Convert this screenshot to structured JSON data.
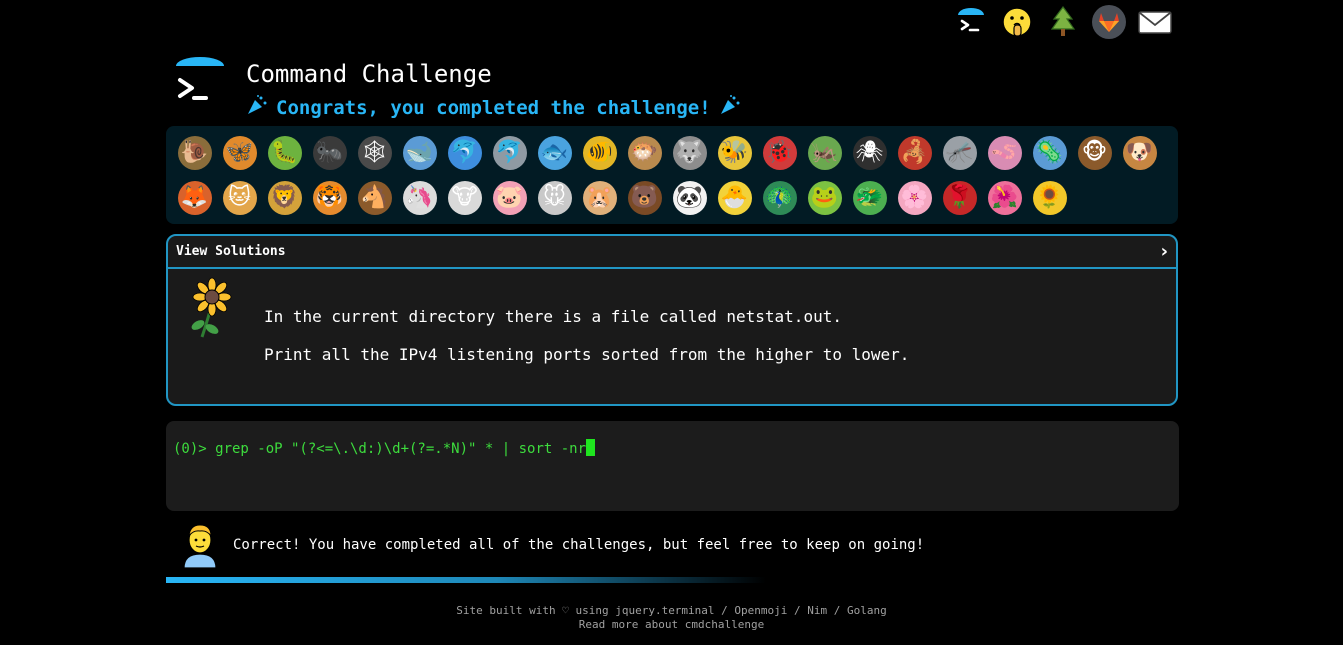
{
  "top_icons": [
    {
      "name": "terminal-icon"
    },
    {
      "name": "shushing-face-icon"
    },
    {
      "name": "tree-icon"
    },
    {
      "name": "gitlab-icon"
    },
    {
      "name": "mail-icon"
    }
  ],
  "header": {
    "title": "Command Challenge",
    "subtitle": "Congrats, you completed the challenge!",
    "accent_color": "#29b6f6"
  },
  "animals": [
    {
      "name": "snail-icon",
      "glyph": "🐌",
      "bg": "#8a6d3b"
    },
    {
      "name": "butterfly-icon",
      "glyph": "🦋",
      "bg": "#e08a2c"
    },
    {
      "name": "caterpillar-icon",
      "glyph": "🐛",
      "bg": "#6db33f"
    },
    {
      "name": "ant-icon",
      "glyph": "🐜",
      "bg": "#3a3a3a"
    },
    {
      "name": "spider-web-icon",
      "glyph": "🕸",
      "bg": "#4a4a4a"
    },
    {
      "name": "whale-icon",
      "glyph": "🐋",
      "bg": "#5b9bd5"
    },
    {
      "name": "dolphin-blue-icon",
      "glyph": "🐬",
      "bg": "#3e8ede"
    },
    {
      "name": "dolphin-gray-icon",
      "glyph": "🐬",
      "bg": "#8f9aa3"
    },
    {
      "name": "fish-icon",
      "glyph": "🐟",
      "bg": "#4aa3df"
    },
    {
      "name": "tropical-fish-icon",
      "glyph": "🐠",
      "bg": "#e3b626"
    },
    {
      "name": "blowfish-icon",
      "glyph": "🐡",
      "bg": "#b98a4e"
    },
    {
      "name": "wolf-icon",
      "glyph": "🐺",
      "bg": "#8d8d8d"
    },
    {
      "name": "bee-icon",
      "glyph": "🐝",
      "bg": "#e8c53a"
    },
    {
      "name": "ladybug-icon",
      "glyph": "🐞",
      "bg": "#d13b3b"
    },
    {
      "name": "cricket-icon",
      "glyph": "🦗",
      "bg": "#6aa84f"
    },
    {
      "name": "spider-icon",
      "glyph": "🕷",
      "bg": "#2f2f2f"
    },
    {
      "name": "scorpion-icon",
      "glyph": "🦂",
      "bg": "#c0392b"
    },
    {
      "name": "mosquito-icon",
      "glyph": "🦟",
      "bg": "#9aa0a6"
    },
    {
      "name": "worm-icon",
      "glyph": "🪱",
      "bg": "#d98cb3"
    },
    {
      "name": "microbe-icon",
      "glyph": "🦠",
      "bg": "#5b9bd5"
    },
    {
      "name": "monkey-icon",
      "glyph": "🐵",
      "bg": "#8b5a2b"
    },
    {
      "name": "dog-icon",
      "glyph": "🐶",
      "bg": "#c68642"
    },
    {
      "name": "fox-icon",
      "glyph": "🦊",
      "bg": "#d9622b"
    },
    {
      "name": "cat-icon",
      "glyph": "🐱",
      "bg": "#e3a64a"
    },
    {
      "name": "lion-icon",
      "glyph": "🦁",
      "bg": "#d4a23a"
    },
    {
      "name": "tiger-icon",
      "glyph": "🐯",
      "bg": "#e58b2e"
    },
    {
      "name": "horse-icon",
      "glyph": "🐴",
      "bg": "#8b5a2b"
    },
    {
      "name": "unicorn-icon",
      "glyph": "🦄",
      "bg": "#dcdcdc"
    },
    {
      "name": "cow-icon",
      "glyph": "🐮",
      "bg": "#d9d9d9"
    },
    {
      "name": "pig-icon",
      "glyph": "🐷",
      "bg": "#f2a0b5"
    },
    {
      "name": "mouse-icon",
      "glyph": "🐭",
      "bg": "#c9c9c9"
    },
    {
      "name": "hamster-icon",
      "glyph": "🐹",
      "bg": "#e0b07a"
    },
    {
      "name": "bear-icon",
      "glyph": "🐻",
      "bg": "#7a4a25"
    },
    {
      "name": "panda-icon",
      "glyph": "🐼",
      "bg": "#f2f2f2"
    },
    {
      "name": "hatching-chick-icon",
      "glyph": "🐣",
      "bg": "#f2d23a"
    },
    {
      "name": "peacock-icon",
      "glyph": "🦚",
      "bg": "#2e8b57"
    },
    {
      "name": "frog-icon",
      "glyph": "🐸",
      "bg": "#7cc242"
    },
    {
      "name": "dragon-icon",
      "glyph": "🐲",
      "bg": "#4caf50"
    },
    {
      "name": "cherry-blossom-icon",
      "glyph": "🌸",
      "bg": "#f4a7c1"
    },
    {
      "name": "rose-icon",
      "glyph": "🌹",
      "bg": "#c62828"
    },
    {
      "name": "hibiscus-icon",
      "glyph": "🌺",
      "bg": "#ef6f9a"
    },
    {
      "name": "sunflower-icon",
      "glyph": "🌻",
      "bg": "#f2c82a"
    }
  ],
  "solutions": {
    "header_label": "View Solutions",
    "chevron": "›",
    "description_line1": "In the current directory there is a file called netstat.out.",
    "description_line2": "Print all the IPv4 listening ports sorted from the higher to lower."
  },
  "terminal": {
    "prompt": "(0)>",
    "input_value": " grep -oP \"(?<=\\.\\d:)\\d+(?=.*N)\" * | sort -nr",
    "text_color": "#3ddc3d"
  },
  "result": {
    "message": "Correct! You have completed all of the challenges, but feel free to keep on going!"
  },
  "footer": {
    "line1": "Site built with ♡ using jquery.terminal / Openmoji / Nim / Golang",
    "line2": "Read more about cmdchallenge"
  }
}
